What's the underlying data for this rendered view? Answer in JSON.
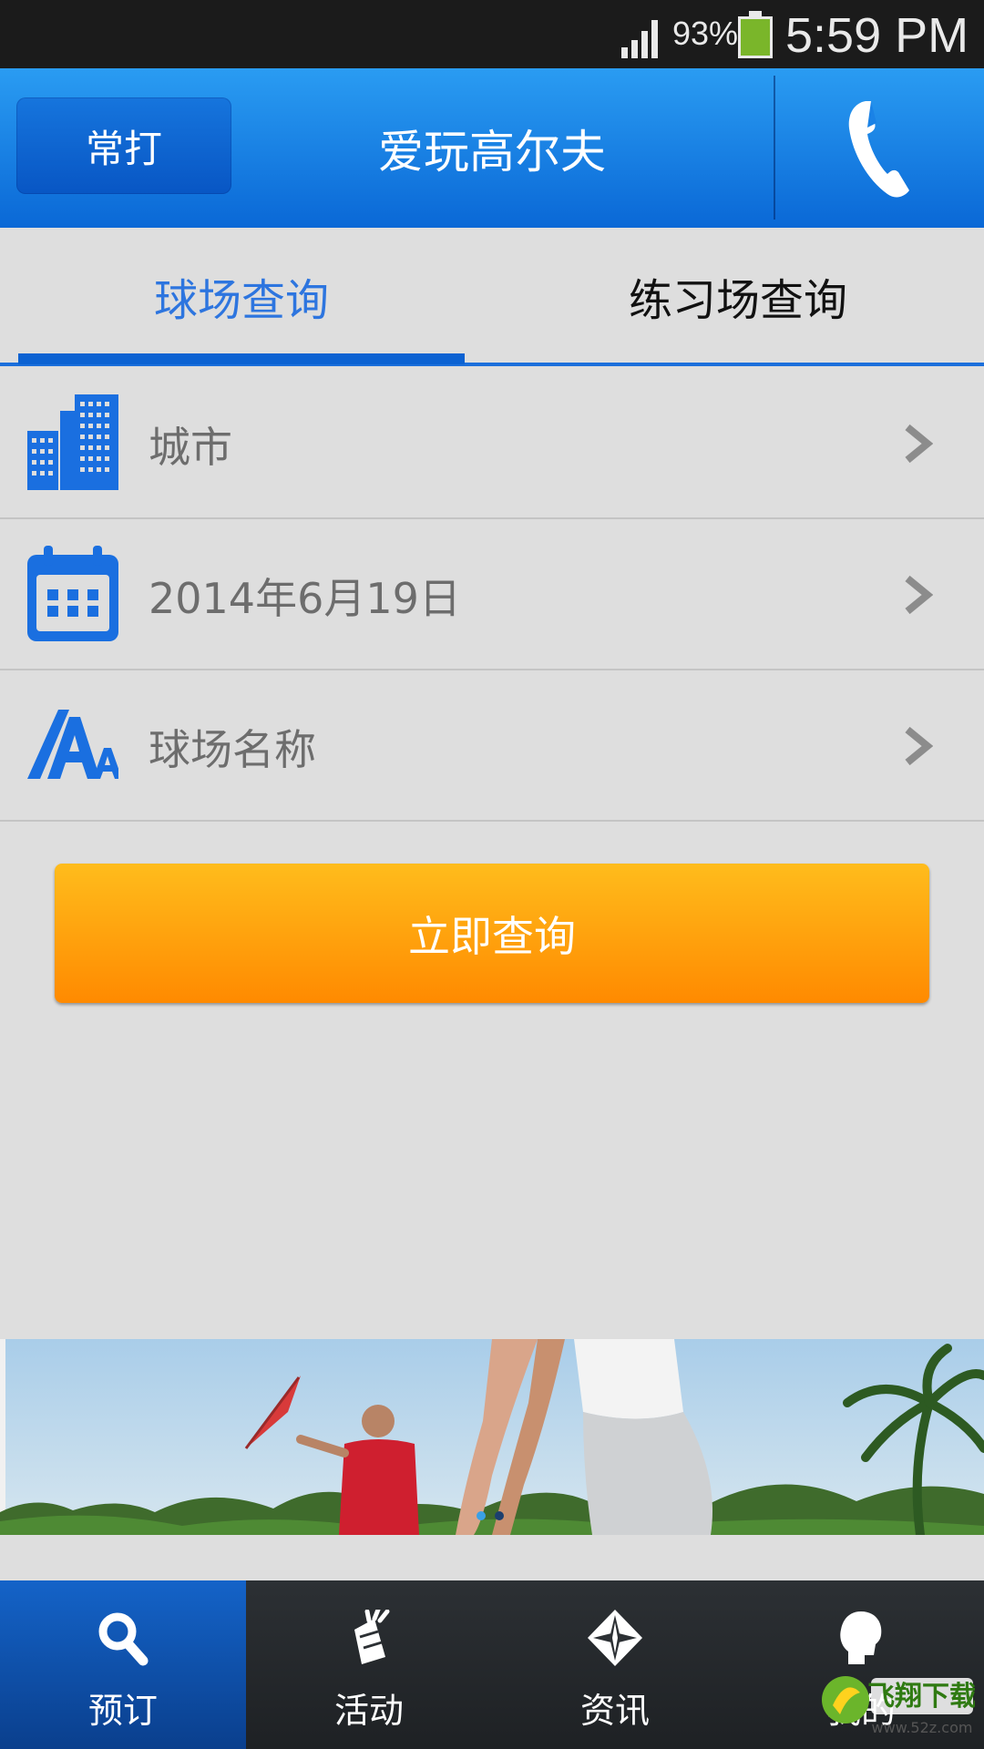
{
  "status_bar": {
    "battery_percent": "93%",
    "time": "5:59 PM"
  },
  "header": {
    "favorites_button": "常打",
    "title": "爱玩高尔夫",
    "phone_icon": "phone-icon"
  },
  "tabs": [
    {
      "label": "球场查询",
      "active": true
    },
    {
      "label": "练习场查询",
      "active": false
    }
  ],
  "form": {
    "rows": [
      {
        "icon": "city-buildings-icon",
        "label": "城市"
      },
      {
        "icon": "calendar-icon",
        "label": "2014年6月19日"
      },
      {
        "icon": "font-size-icon",
        "label": "球场名称"
      }
    ],
    "submit_label": "立即查询"
  },
  "banner": {
    "slides": 2,
    "current_slide": 1
  },
  "bottom_nav": [
    {
      "icon": "search-icon",
      "label": "预订",
      "active": true
    },
    {
      "icon": "golf-bag-icon",
      "label": "活动",
      "active": false
    },
    {
      "icon": "compass-icon",
      "label": "资讯",
      "active": false
    },
    {
      "icon": "person-head-icon",
      "label": "我的",
      "active": false
    }
  ],
  "watermark": {
    "text": "飞翔下载",
    "url_text": "www.52z.com"
  },
  "colors": {
    "header_blue": "#1a82e6",
    "active_tab_blue": "#2d75df",
    "query_orange": "#ff9a05",
    "icon_blue": "#1a6fe0"
  }
}
